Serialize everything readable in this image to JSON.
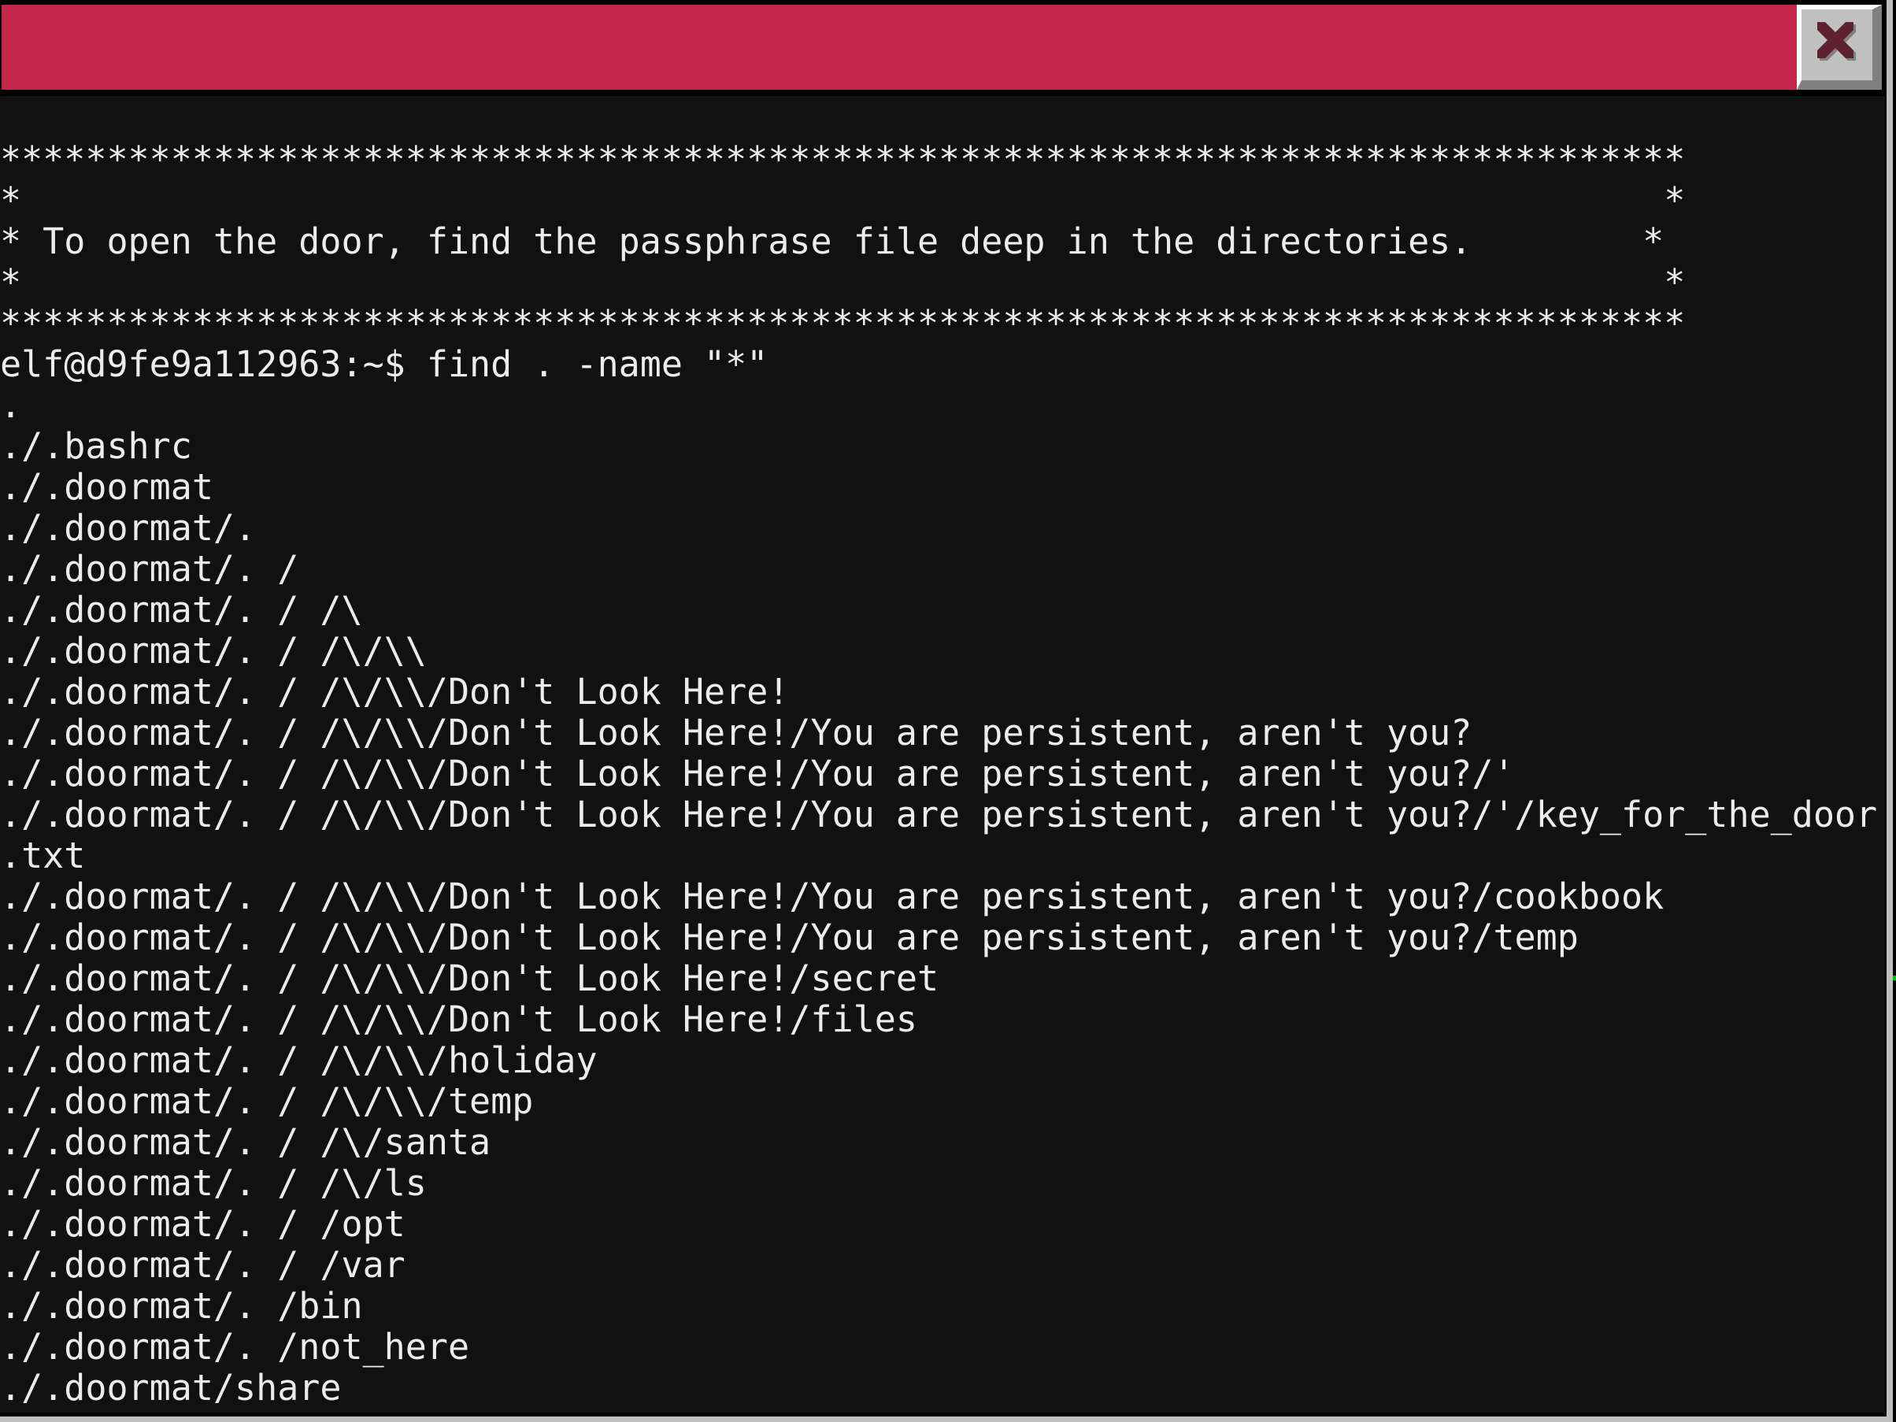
{
  "window": {
    "title_bar_color": "#c4274c",
    "close_button": {
      "icon": "close-icon",
      "icon_color": "#5e2233",
      "background": "#c0c0c0"
    }
  },
  "terminal": {
    "background": "#111111",
    "foreground": "#ececec",
    "lines": [
      "*******************************************************************************",
      "*                                                                             *",
      "* To open the door, find the passphrase file deep in the directories.        *",
      "*                                                                             *",
      "*******************************************************************************",
      "elf@d9fe9a112963:~$ find . -name \"*\"",
      ".",
      "./.bashrc",
      "./.doormat",
      "./.doormat/.",
      "./.doormat/. /",
      "./.doormat/. / /\\",
      "./.doormat/. / /\\/\\\\",
      "./.doormat/. / /\\/\\\\/Don't Look Here!",
      "./.doormat/. / /\\/\\\\/Don't Look Here!/You are persistent, aren't you?",
      "./.doormat/. / /\\/\\\\/Don't Look Here!/You are persistent, aren't you?/'",
      "./.doormat/. / /\\/\\\\/Don't Look Here!/You are persistent, aren't you?/'/key_for_the_door",
      ".txt",
      "./.doormat/. / /\\/\\\\/Don't Look Here!/You are persistent, aren't you?/cookbook",
      "./.doormat/. / /\\/\\\\/Don't Look Here!/You are persistent, aren't you?/temp",
      "./.doormat/. / /\\/\\\\/Don't Look Here!/secret",
      "./.doormat/. / /\\/\\\\/Don't Look Here!/files",
      "./.doormat/. / /\\/\\\\/holiday",
      "./.doormat/. / /\\/\\\\/temp",
      "./.doormat/. / /\\/santa",
      "./.doormat/. / /\\/ls",
      "./.doormat/. / /opt",
      "./.doormat/. / /var",
      "./.doormat/. /bin",
      "./.doormat/. /not_here",
      "./.doormat/share"
    ]
  }
}
